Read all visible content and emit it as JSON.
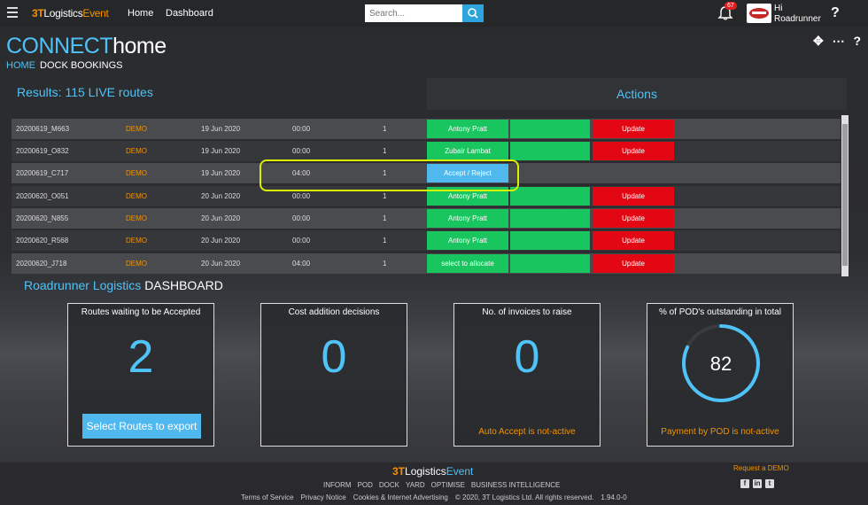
{
  "topbar": {
    "logo_3t": "3T",
    "logo_logistics": "Logistics",
    "logo_event": "Event",
    "nav": [
      "Home",
      "Dashboard"
    ],
    "search_placeholder": "Search...",
    "notification_count": "67",
    "greeting": "Hi",
    "user": "Roadrunner",
    "help": "?"
  },
  "header": {
    "brand_connect": "CONNECT",
    "brand_home": "home",
    "breadcrumb": [
      "HOME",
      "DOCK BOOKINGS"
    ]
  },
  "results": {
    "label": "Results: 115 LIVE routes",
    "actions_label": "Actions"
  },
  "rows": [
    {
      "id": "20200619_M663",
      "client": "DEMO",
      "date": "19 Jun 2020",
      "time": "00:00",
      "count": "1",
      "action1": "Antony Pratt",
      "action3": "Update"
    },
    {
      "id": "20200619_O832",
      "client": "DEMO",
      "date": "19 Jun 2020",
      "time": "00:00",
      "count": "1",
      "action1": "Zubair Lambat",
      "action3": "Update"
    },
    {
      "id": "20200619_C717",
      "client": "DEMO",
      "date": "19 Jun 2020",
      "time": "04:00",
      "count": "1",
      "action1": "Accept / Reject",
      "action3": ""
    },
    {
      "id": "20200620_O051",
      "client": "DEMO",
      "date": "20 Jun 2020",
      "time": "00:00",
      "count": "1",
      "action1": "Antony Pratt",
      "action3": "Update"
    },
    {
      "id": "20200620_N855",
      "client": "DEMO",
      "date": "20 Jun 2020",
      "time": "00:00",
      "count": "1",
      "action1": "Antony Pratt",
      "action3": "Update"
    },
    {
      "id": "20200620_R568",
      "client": "DEMO",
      "date": "20 Jun 2020",
      "time": "00:00",
      "count": "1",
      "action1": "Antony Pratt",
      "action3": "Update"
    },
    {
      "id": "20200620_J718",
      "client": "DEMO",
      "date": "20 Jun 2020",
      "time": "04:00",
      "count": "1",
      "action1": "select to allocate",
      "action3": "Update"
    }
  ],
  "dashboard": {
    "title_company": "Roadrunner Logistics",
    "title_label": "DASHBOARD",
    "cards": [
      {
        "title": "Routes waiting to be Accepted",
        "value": "2",
        "button": "Select Routes to export"
      },
      {
        "title": "Cost addition decisions",
        "value": "0"
      },
      {
        "title": "No. of invoices to raise",
        "value": "0",
        "footer": "Auto Accept is not-active"
      },
      {
        "title": "% of POD's outstanding in total",
        "value": "82",
        "percent": 82,
        "footer": "Payment by POD is not-active"
      }
    ]
  },
  "footer": {
    "logo_3t": "3T",
    "logo_logistics": "Logistics",
    "logo_event": "Event",
    "links": [
      "INFORM",
      "POD",
      "DOCK",
      "YARD",
      "OPTIMISE",
      "BUSINESS INTELLIGENCE"
    ],
    "legal": [
      "Terms of Service",
      "Privacy Notice",
      "Cookies & Internet Advertising",
      "© 2020, 3T Logistics Ltd. All rights reserved.",
      "1.94.0-0"
    ],
    "request_demo": "Request a DEMO"
  },
  "colors": {
    "accent": "#4fc3f7",
    "orange": "#f39200",
    "green": "#19c55e",
    "red": "#e30613",
    "blue": "#4fb8ee"
  }
}
